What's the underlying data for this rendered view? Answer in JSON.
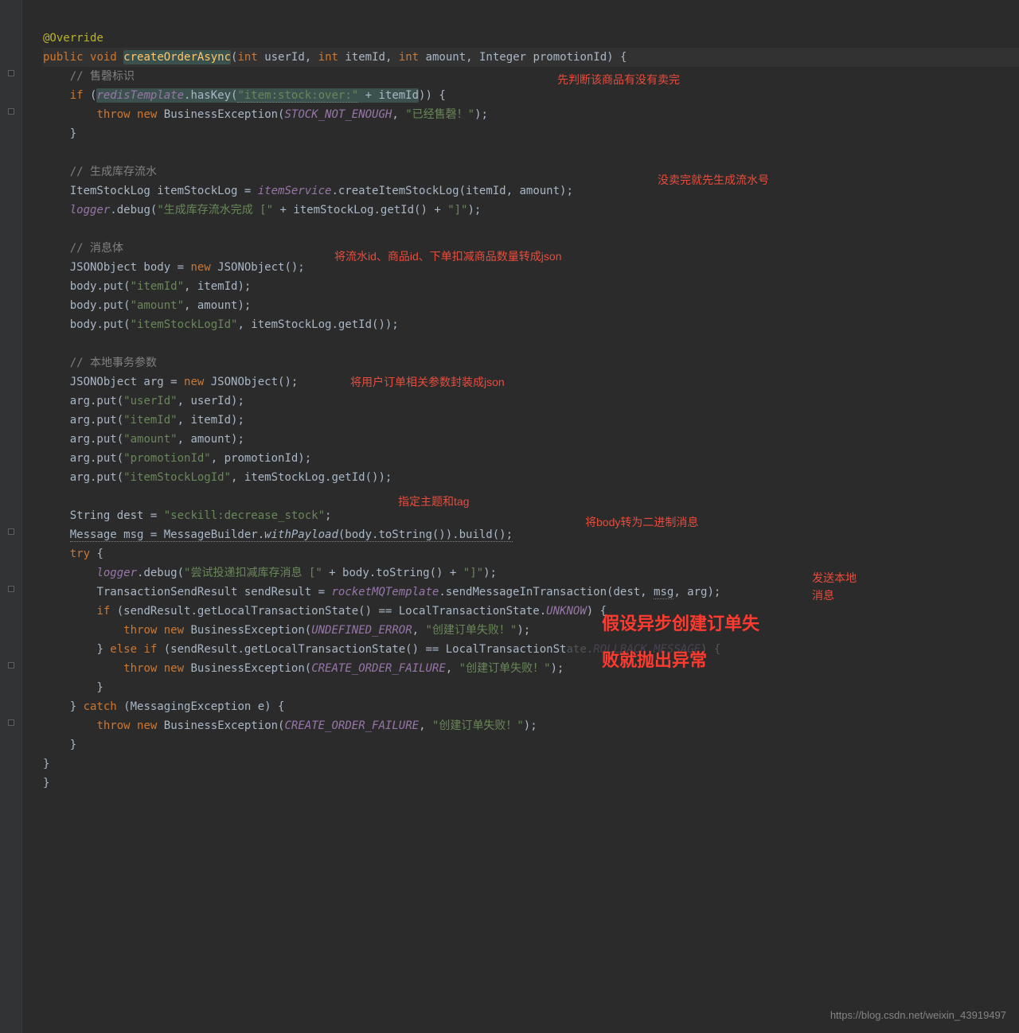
{
  "annotations": {
    "a1": "先判断该商品有没有卖完",
    "a2": "没卖完就先生成流水号",
    "a3": "将流水id、商品id、下单扣减商品数量转成json",
    "a4": "将用户订单相关参数封装成json",
    "a5": "指定主题和tag",
    "a6": "将body转为二进制消息",
    "a7": "发送本地",
    "a7b": "消息",
    "a8": "假设异步创建订单失",
    "a9": "败就抛出异常"
  },
  "watermark": "https://blog.csdn.net/weixin_43919497",
  "code": {
    "l1_anno": "@Override",
    "l2_kw_public": "public",
    "l2_kw_void": "void",
    "l2_mname": "createOrderAsync",
    "l2_int": "int",
    "l2_p1": "userId",
    "l2_p2": "itemId",
    "l2_p3": "amount",
    "l2_integer": "Integer",
    "l2_p4": "promotionId",
    "c1": "// 售磬标识",
    "l3_if": "if",
    "l3_field": "redisTemplate",
    "l3_has": ".hasKey(",
    "l3_str": "\"item:stock:over:\"",
    "l3_plus": " + itemId",
    "l3_close": ")) {",
    "l4_throw": "throw",
    "l4_new": "new",
    "l4_cls": "BusinessException(",
    "l4_const": "STOCK_NOT_ENOUGH",
    "l4_str": "\"已经售磬！\"",
    "c2": "// 生成库存流水",
    "l5a": "ItemStockLog itemStockLog = ",
    "l5_field": "itemService",
    "l5b": ".createItemStockLog(itemId, amount);",
    "l6_field": "logger",
    "l6a": ".debug(",
    "l6_str1": "\"生成库存流水完成 [\"",
    "l6b": " + itemStockLog.getId() + ",
    "l6_str2": "\"]\"",
    "l6c": ");",
    "c3": "// 消息体",
    "l7a": "JSONObject body = ",
    "l7_new": "new",
    "l7b": " JSONObject();",
    "l8a": "body.put(",
    "l8_str": "\"itemId\"",
    "l8b": ", itemId);",
    "l9a": "body.put(",
    "l9_str": "\"amount\"",
    "l9b": ", amount);",
    "l10a": "body.put(",
    "l10_str": "\"itemStockLogId\"",
    "l10b": ", itemStockLog.getId());",
    "c4": "// 本地事务参数",
    "l11a": "JSONObject arg = ",
    "l11_new": "new",
    "l11b": " JSONObject();",
    "l12a": "arg.put(",
    "l12_str": "\"userId\"",
    "l12b": ", userId);",
    "l13a": "arg.put(",
    "l13_str": "\"itemId\"",
    "l13b": ", itemId);",
    "l14a": "arg.put(",
    "l14_str": "\"amount\"",
    "l14b": ", amount);",
    "l15a": "arg.put(",
    "l15_str": "\"promotionId\"",
    "l15b": ", promotionId);",
    "l16a": "arg.put(",
    "l16_str": "\"itemStockLogId\"",
    "l16b": ", itemStockLog.getId());",
    "l17a": "String dest = ",
    "l17_str": "\"seckill:decrease_stock\"",
    "l17b": ";",
    "l18a": "Message msg = MessageBuilder.",
    "l18_wp": "withPayload",
    "l18b": "(body.toString()).build();",
    "l19_try": "try",
    "l19b": " {",
    "l20_field": "logger",
    "l20a": ".debug(",
    "l20_str1": "\"尝试投递扣减库存消息 [\"",
    "l20b": " + body.toString() + ",
    "l20_str2": "\"]\"",
    "l20c": ");",
    "l21a": "TransactionSendResult sendResult = ",
    "l21_field": "rocketMQTemplate",
    "l21b": ".sendMessageInTransaction(dest, ",
    "l21_msg": "msg",
    "l21c": ", arg);",
    "l22_if": "if",
    "l22a": " (sendResult.getLocalTransactionState() == LocalTransactionState.",
    "l22_const": "UNKNOW",
    "l22b": ") {",
    "l23_throw": "throw",
    "l23_new": "new",
    "l23_cls": "BusinessException(",
    "l23_const": "UNDEFINED_ERROR",
    "l23_str": "\"创建订单失败！\"",
    "l24a": "} ",
    "l24_else": "else if",
    "l24b": " (sendResult.getLocalTransactionState() == LocalTransactionSt",
    "l24_hidden": "ate.",
    "l24_const": "ROLLBACK_MESSAGE",
    "l24c": ") {",
    "l25_throw": "throw",
    "l25_new": "new",
    "l25_cls": "BusinessException(",
    "l25_const": "CREATE_ORDER_FAILURE",
    "l25_str": "\"创建订单失败！\"",
    "l26a": "} ",
    "l26_catch": "catch",
    "l26b": " (MessagingException e) {",
    "l27_throw": "throw",
    "l27_new": "new",
    "l27_cls": "BusinessException(",
    "l27_const": "CREATE_ORDER_FAILURE",
    "l27_str": "\"创建订单失败！\""
  }
}
